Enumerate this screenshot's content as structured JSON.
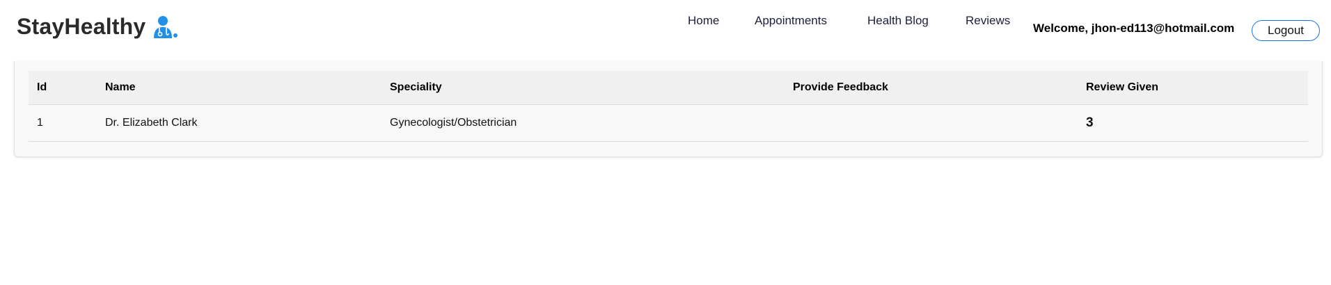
{
  "brand": {
    "name": "StayHealthy",
    "icon": "doctor-icon",
    "accent_color": "#2190e8"
  },
  "nav": {
    "links": [
      {
        "label": "Home"
      },
      {
        "label": "Appointments"
      },
      {
        "label": "Health Blog"
      },
      {
        "label": "Reviews"
      }
    ],
    "welcome_text": "Welcome, jhon-ed113@hotmail.com",
    "logout_label": "Logout",
    "logout_border_color": "#1e73e8"
  },
  "table": {
    "headers": {
      "id": "Id",
      "name": "Name",
      "speciality": "Speciality",
      "feedback": "Provide Feedback",
      "review": "Review Given"
    },
    "rows": [
      {
        "id": "1",
        "name": "Dr. Elizabeth Clark",
        "speciality": "Gynecologist/Obstetrician",
        "feedback": "",
        "review": "3"
      }
    ]
  }
}
